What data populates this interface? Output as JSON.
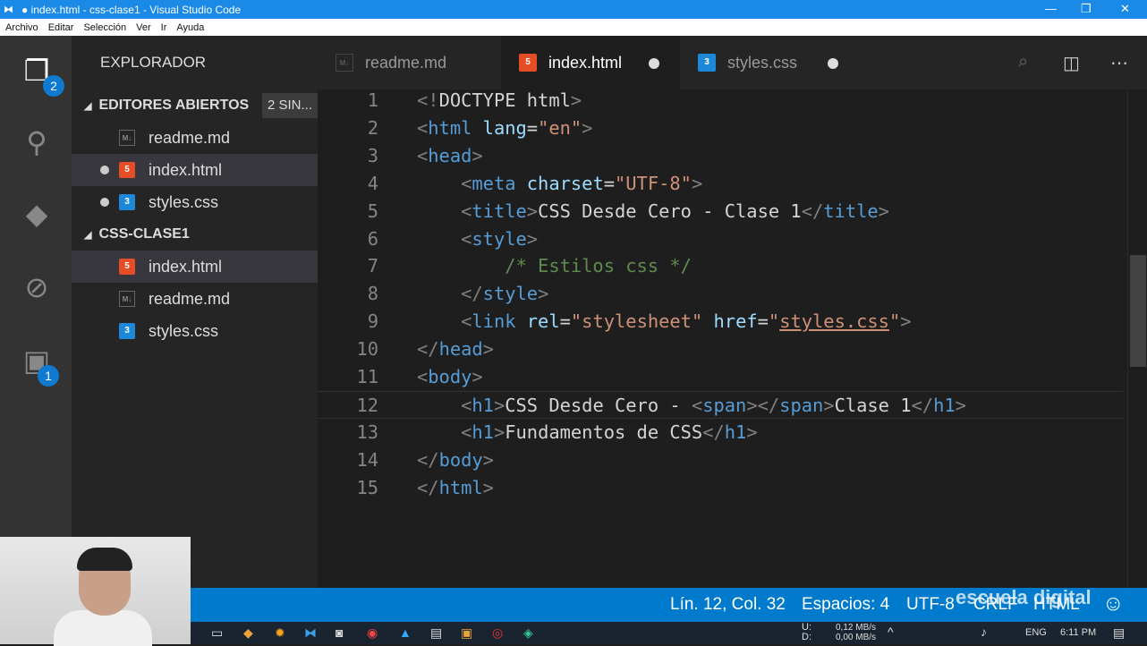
{
  "window": {
    "title": "● index.html - css-clase1 - Visual Studio Code",
    "minimize": "—",
    "maximize": "❐",
    "close": "✕"
  },
  "menu": [
    "Archivo",
    "Editar",
    "Selección",
    "Ver",
    "Ir",
    "Ayuda"
  ],
  "activity": {
    "explorer_badge": "2",
    "extensions_badge": "1"
  },
  "sidebar": {
    "title": "EXPLORADOR",
    "open_editors": {
      "label": "EDITORES ABIERTOS",
      "pill": "2 SIN...",
      "items": [
        {
          "name": "readme.md",
          "type": "md",
          "dirty": false,
          "selected": false
        },
        {
          "name": "index.html",
          "type": "html",
          "dirty": true,
          "selected": true
        },
        {
          "name": "styles.css",
          "type": "css",
          "dirty": true,
          "selected": false
        }
      ]
    },
    "folder": {
      "label": "CSS-CLASE1",
      "items": [
        {
          "name": "index.html",
          "type": "html",
          "selected": true
        },
        {
          "name": "readme.md",
          "type": "md",
          "selected": false
        },
        {
          "name": "styles.css",
          "type": "css",
          "selected": false
        }
      ]
    }
  },
  "tabs": [
    {
      "label": "readme.md",
      "type": "md",
      "active": false,
      "dirty": false
    },
    {
      "label": "index.html",
      "type": "html",
      "active": true,
      "dirty": true
    },
    {
      "label": "styles.css",
      "type": "css",
      "active": false,
      "dirty": true
    }
  ],
  "editor": {
    "current_line": 12,
    "lines": [
      [
        [
          "b",
          "<!"
        ],
        [
          "x",
          "DOCTYPE html"
        ],
        [
          "b",
          ">"
        ]
      ],
      [
        [
          "b",
          "<"
        ],
        [
          "t",
          "html"
        ],
        [
          "x",
          " "
        ],
        [
          "a",
          "lang"
        ],
        [
          "x",
          "="
        ],
        [
          "s",
          "\"en\""
        ],
        [
          "b",
          ">"
        ]
      ],
      [
        [
          "b",
          "<"
        ],
        [
          "t",
          "head"
        ],
        [
          "b",
          ">"
        ]
      ],
      [
        [
          "x",
          "    "
        ],
        [
          "b",
          "<"
        ],
        [
          "t",
          "meta"
        ],
        [
          "x",
          " "
        ],
        [
          "a",
          "charset"
        ],
        [
          "x",
          "="
        ],
        [
          "s",
          "\"UTF-8\""
        ],
        [
          "b",
          ">"
        ]
      ],
      [
        [
          "x",
          "    "
        ],
        [
          "b",
          "<"
        ],
        [
          "t",
          "title"
        ],
        [
          "b",
          ">"
        ],
        [
          "x",
          "CSS Desde Cero - Clase 1"
        ],
        [
          "b",
          "</"
        ],
        [
          "t",
          "title"
        ],
        [
          "b",
          ">"
        ]
      ],
      [
        [
          "x",
          "    "
        ],
        [
          "b",
          "<"
        ],
        [
          "t",
          "style"
        ],
        [
          "b",
          ">"
        ]
      ],
      [
        [
          "x",
          "        "
        ],
        [
          "c",
          "/* Estilos css */"
        ]
      ],
      [
        [
          "x",
          "    "
        ],
        [
          "b",
          "</"
        ],
        [
          "t",
          "style"
        ],
        [
          "b",
          ">"
        ]
      ],
      [
        [
          "x",
          "    "
        ],
        [
          "b",
          "<"
        ],
        [
          "t",
          "link"
        ],
        [
          "x",
          " "
        ],
        [
          "a",
          "rel"
        ],
        [
          "x",
          "="
        ],
        [
          "s",
          "\"stylesheet\""
        ],
        [
          "x",
          " "
        ],
        [
          "a",
          "href"
        ],
        [
          "x",
          "="
        ],
        [
          "s",
          "\""
        ],
        [
          "u",
          "styles.css"
        ],
        [
          "s",
          "\""
        ],
        [
          "b",
          ">"
        ]
      ],
      [
        [
          "b",
          "</"
        ],
        [
          "t",
          "head"
        ],
        [
          "b",
          ">"
        ]
      ],
      [
        [
          "b",
          "<"
        ],
        [
          "t",
          "body"
        ],
        [
          "b",
          ">"
        ]
      ],
      [
        [
          "x",
          "    "
        ],
        [
          "b",
          "<"
        ],
        [
          "t",
          "h1"
        ],
        [
          "b",
          ">"
        ],
        [
          "x",
          "CSS Desde Cero - "
        ],
        [
          "b",
          "<"
        ],
        [
          "t",
          "span"
        ],
        [
          "b",
          ">"
        ],
        [
          "b",
          "</"
        ],
        [
          "t",
          "span"
        ],
        [
          "b",
          ">"
        ],
        [
          "x",
          "Clase 1"
        ],
        [
          "b",
          "</"
        ],
        [
          "t",
          "h1"
        ],
        [
          "b",
          ">"
        ]
      ],
      [
        [
          "x",
          "    "
        ],
        [
          "b",
          "<"
        ],
        [
          "t",
          "h1"
        ],
        [
          "b",
          ">"
        ],
        [
          "x",
          "Fundamentos de CSS"
        ],
        [
          "b",
          "</"
        ],
        [
          "t",
          "h1"
        ],
        [
          "b",
          ">"
        ]
      ],
      [
        [
          "b",
          "</"
        ],
        [
          "t",
          "body"
        ],
        [
          "b",
          ">"
        ]
      ],
      [
        [
          "b",
          "</"
        ],
        [
          "t",
          "html"
        ],
        [
          "b",
          ">"
        ]
      ]
    ]
  },
  "status": {
    "position": "Lín. 12, Col. 32",
    "spaces": "Espacios: 4",
    "encoding": "UTF-8",
    "eol": "CRLF",
    "language": "HTML",
    "feedback": "☺"
  },
  "taskbar": {
    "net_up_label": "U:",
    "net_up": "0,12 MB/s",
    "net_down_label": "D:",
    "net_down": "0,00 MB/s",
    "lang": "ENG",
    "time": "6:11 PM"
  },
  "watermark": "escuela digital"
}
